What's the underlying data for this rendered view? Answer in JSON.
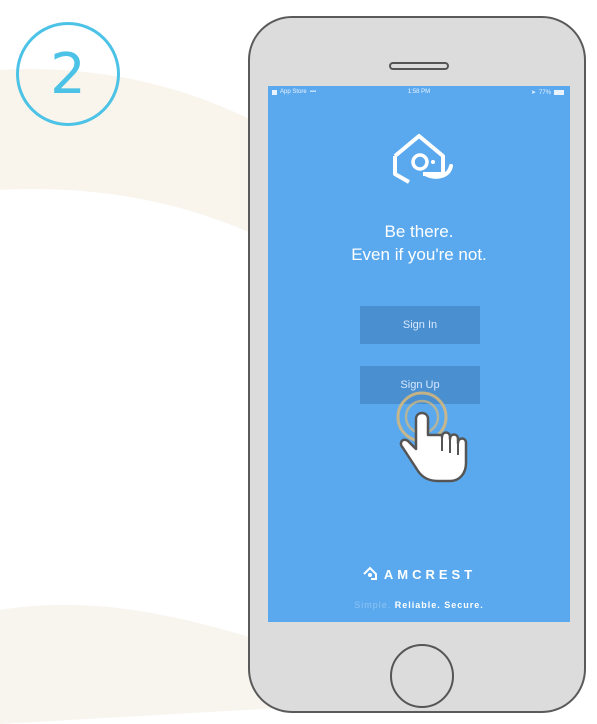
{
  "step": {
    "number": "2"
  },
  "status_bar": {
    "carrier": "App Store",
    "time": "1:58 PM",
    "battery": "77%"
  },
  "hero": {
    "tagline_line1": "Be there.",
    "tagline_line2": "Even if you're not."
  },
  "buttons": {
    "sign_in": "Sign In",
    "sign_up": "Sign Up"
  },
  "brand": {
    "name": "AMCREST",
    "slogan_part1": "Simple.",
    "slogan_part2": "Reliable. Secure."
  },
  "colors": {
    "screen_bg": "#5aa9ee",
    "button_bg": "#4a8fd0",
    "step_accent": "#4cc3e6",
    "tap_ring": "#d9b97a"
  },
  "icons": {
    "app": "home-camera-logo-icon",
    "brand": "amcrest-logo-icon",
    "pointer": "hand-pointer-icon"
  }
}
